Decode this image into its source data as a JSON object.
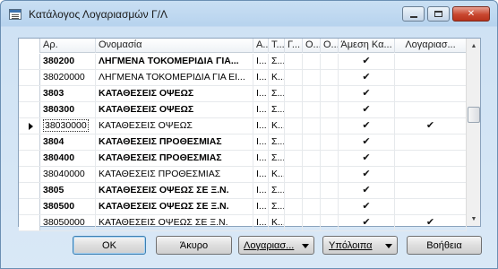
{
  "window": {
    "title": "Κατάλογος Λογαριασμών Γ/Λ",
    "minimize_label": "",
    "maximize_label": "",
    "close_label": "✕"
  },
  "grid": {
    "columns": [
      "Αρ.",
      "Ονομασία",
      "Α...",
      "Τ...",
      "Γ...",
      "Ο...",
      "Ο...",
      "Άμεση Κα...",
      "Λογαριασ..."
    ],
    "rows": [
      {
        "no": "380200",
        "name": "ΛΗΓΜΕΝΑ ΤΟΚΟΜΕΡΙΔΙΑ ΓΙΑ...",
        "a": "Ι...",
        "t": "Σ...",
        "g": "",
        "o1": "",
        "o2": "",
        "direct": "✔",
        "account": "",
        "bold": true,
        "current": false
      },
      {
        "no": "38020000",
        "name": "ΛΗΓΜΕΝΑ ΤΟΚΟΜΕΡΙΔΙΑ ΓΙΑ ΕΙ...",
        "a": "Ι...",
        "t": "Κ...",
        "g": "",
        "o1": "",
        "o2": "",
        "direct": "✔",
        "account": "",
        "bold": false,
        "current": false
      },
      {
        "no": "3803",
        "name": "ΚΑΤΑΘΕΣΕΙΣ ΟΨΕΩΣ",
        "a": "Ι...",
        "t": "Σ...",
        "g": "",
        "o1": "",
        "o2": "",
        "direct": "✔",
        "account": "",
        "bold": true,
        "current": false
      },
      {
        "no": "380300",
        "name": "ΚΑΤΑΘΕΣΕΙΣ ΟΨΕΩΣ",
        "a": "Ι...",
        "t": "Σ...",
        "g": "",
        "o1": "",
        "o2": "",
        "direct": "✔",
        "account": "",
        "bold": true,
        "current": false
      },
      {
        "no": "38030000",
        "name": "ΚΑΤΑΘΕΣΕΙΣ ΟΨΕΩΣ",
        "a": "Ι...",
        "t": "Κ...",
        "g": "",
        "o1": "",
        "o2": "",
        "direct": "✔",
        "account": "✔",
        "bold": false,
        "current": true
      },
      {
        "no": "3804",
        "name": "ΚΑΤΑΘΕΣΕΙΣ ΠΡΟΘΕΣΜΙΑΣ",
        "a": "Ι...",
        "t": "Σ...",
        "g": "",
        "o1": "",
        "o2": "",
        "direct": "✔",
        "account": "",
        "bold": true,
        "current": false
      },
      {
        "no": "380400",
        "name": "ΚΑΤΑΘΕΣΕΙΣ ΠΡΟΘΕΣΜΙΑΣ",
        "a": "Ι...",
        "t": "Σ...",
        "g": "",
        "o1": "",
        "o2": "",
        "direct": "✔",
        "account": "",
        "bold": true,
        "current": false
      },
      {
        "no": "38040000",
        "name": "ΚΑΤΑΘΕΣΕΙΣ ΠΡΟΘΕΣΜΙΑΣ",
        "a": "Ι...",
        "t": "Κ...",
        "g": "",
        "o1": "",
        "o2": "",
        "direct": "✔",
        "account": "",
        "bold": false,
        "current": false
      },
      {
        "no": "3805",
        "name": "ΚΑΤΑΘΕΣΕΙΣ ΟΨΕΩΣ ΣΕ Ξ.Ν.",
        "a": "Ι...",
        "t": "Σ...",
        "g": "",
        "o1": "",
        "o2": "",
        "direct": "✔",
        "account": "",
        "bold": true,
        "current": false
      },
      {
        "no": "380500",
        "name": "ΚΑΤΑΘΕΣΕΙΣ ΟΨΕΩΣ ΣΕ Ξ.Ν.",
        "a": "Ι...",
        "t": "Σ...",
        "g": "",
        "o1": "",
        "o2": "",
        "direct": "✔",
        "account": "",
        "bold": true,
        "current": false
      },
      {
        "no": "38050000",
        "name": "ΚΑΤΑΘΕΣΕΙΣ ΟΨΕΩΣ ΣΕ Ξ.Ν.",
        "a": "Ι...",
        "t": "Κ...",
        "g": "",
        "o1": "",
        "o2": "",
        "direct": "✔",
        "account": "✔",
        "bold": false,
        "current": false
      }
    ]
  },
  "buttons": {
    "ok": "OK",
    "cancel": "Άκυρο",
    "accounts": "Λογαριασ...",
    "balance": "Υπόλοιπα",
    "help": "Βοήθεια"
  }
}
